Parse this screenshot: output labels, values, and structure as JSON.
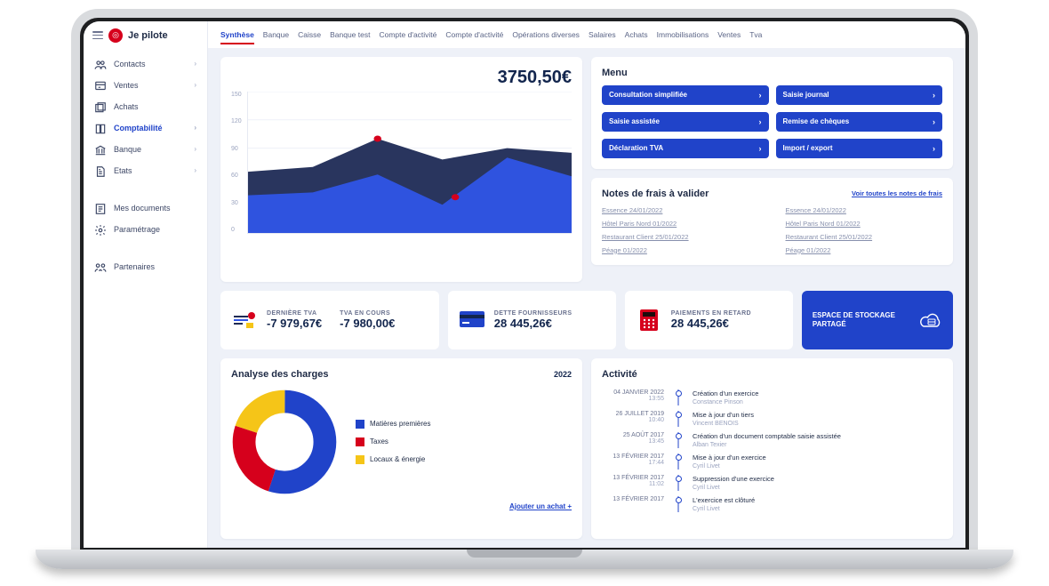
{
  "brand": "Je pilote",
  "sidebar": {
    "items": [
      {
        "label": "Contacts",
        "icon": "users",
        "chev": true
      },
      {
        "label": "Ventes",
        "icon": "ventes",
        "chev": true
      },
      {
        "label": "Achats",
        "icon": "achats"
      },
      {
        "label": "Comptabilité",
        "icon": "compta",
        "chev": true,
        "active": true
      },
      {
        "label": "Banque",
        "icon": "banque",
        "chev": true
      },
      {
        "label": "Etats",
        "icon": "etats",
        "chev": true
      }
    ],
    "secondary": [
      {
        "label": "Mes documents",
        "icon": "docs"
      },
      {
        "label": "Paramétrage",
        "icon": "param"
      }
    ],
    "tertiary": [
      {
        "label": "Partenaires",
        "icon": "part"
      }
    ]
  },
  "topnav": [
    "Synthèse",
    "Banque",
    "Caisse",
    "Banque test",
    "Compte d'activité",
    "Compte d'activité",
    "Opérations diverses",
    "Salaires",
    "Achats",
    "Immobilisations",
    "Ventes",
    "Tva"
  ],
  "topnav_active": 0,
  "balance": "3750,50€",
  "chart_data": {
    "type": "area",
    "ylim": [
      0,
      150
    ],
    "yticks": [
      0,
      30,
      60,
      90,
      120,
      150
    ],
    "x": [
      0,
      1,
      2,
      3,
      4,
      5
    ],
    "series": [
      {
        "name": "back",
        "color": "#1e2a55",
        "values": [
          65,
          70,
          100,
          78,
          90,
          85
        ]
      },
      {
        "name": "front",
        "color": "#2f55e6",
        "values": [
          40,
          43,
          62,
          30,
          80,
          60
        ]
      }
    ],
    "markers": [
      {
        "x": 2,
        "y": 100,
        "color": "#d6001c"
      },
      {
        "x": 3.2,
        "y": 38,
        "color": "#d6001c"
      }
    ]
  },
  "menu": {
    "title": "Menu",
    "items": [
      "Consultation simplifiée",
      "Saisie journal",
      "Saisie assistée",
      "Remise de chèques",
      "Déclaration TVA",
      "Import / export"
    ]
  },
  "notes": {
    "title": "Notes de frais à valider",
    "link": "Voir toutes les notes de frais",
    "col1": [
      "Essence 24/01/2022",
      "Hôtel Paris Nord 01/2022",
      "Restaurant Client 25/01/2022",
      "Péage 01/2022"
    ],
    "col2": [
      "Essence 24/01/2022",
      "Hôtel Paris Nord 01/2022",
      "Restaurant Client 25/01/2022",
      "Péage 01/2022"
    ]
  },
  "kpis": {
    "tva_last_label": "DERNIÈRE TVA",
    "tva_last": "-7 979,67€",
    "tva_cur_label": "TVA EN COURS",
    "tva_cur": "-7 980,00€",
    "debt_label": "DETTE FOURNISSEURS",
    "debt": "28 445,26€",
    "late_label": "PAIEMENTS EN RETARD",
    "late": "28 445,26€"
  },
  "storage": "ESPACE DE STOCKAGE PARTAGÉ",
  "charges": {
    "title": "Analyse des charges",
    "year": "2022",
    "add": "Ajouter un achat +",
    "chart_data": {
      "type": "pie",
      "series": [
        {
          "name": "Matières premières",
          "color": "#2043c9",
          "value": 55
        },
        {
          "name": "Taxes",
          "color": "#d6001c",
          "value": 25
        },
        {
          "name": "Locaux & énergie",
          "color": "#f5c518",
          "value": 20
        }
      ]
    }
  },
  "activity": {
    "title": "Activité",
    "items": [
      {
        "d1": "04 JANVIER 2022",
        "d2": "13:55",
        "t": "Création d'un exercice",
        "s": "Constance Pinson"
      },
      {
        "d1": "26 JUILLET 2019",
        "d2": "10:40",
        "t": "Mise à jour d'un tiers",
        "s": "Vincent BENOIS"
      },
      {
        "d1": "25 AOÛT 2017",
        "d2": "13:45",
        "t": "Création d'un document comptable saisie assistée",
        "s": "Alban Texier"
      },
      {
        "d1": "13 FÉVRIER 2017",
        "d2": "17:44",
        "t": "Mise à jour d'un exercice",
        "s": "Cyril Livet"
      },
      {
        "d1": "13 FÉVRIER 2017",
        "d2": "11:02",
        "t": "Suppression d'une exercice",
        "s": "Cyril Livet"
      },
      {
        "d1": "13 FÉVRIER 2017",
        "d2": "",
        "t": "L'exercice est clôturé",
        "s": "Cyril Livet"
      }
    ]
  }
}
